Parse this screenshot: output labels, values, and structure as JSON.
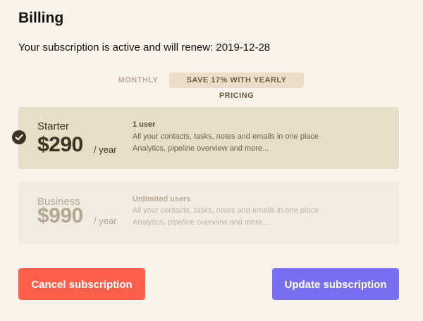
{
  "page": {
    "title": "Billing",
    "status_text": "Your subscription is active and will renew: 2019-12-28"
  },
  "billing_toggle": {
    "monthly_label": "MONTHLY",
    "yearly_label": "SAVE 17% WITH YEARLY PRICING",
    "selected": "yearly"
  },
  "plans": [
    {
      "name": "Starter",
      "price": "$290",
      "period": "/ year",
      "users": "1 user",
      "features": [
        "All your contacts, tasks, notes and emails in one place",
        "Analytics, pipeline overview and more..."
      ],
      "selected": true
    },
    {
      "name": "Business",
      "price": "$990",
      "period": "/ year",
      "users": "Unlimited users",
      "features": [
        "All your contacts, tasks, notes and emails in one place",
        "Analytics, pipeline overview and more..."
      ],
      "selected": false
    }
  ],
  "actions": {
    "cancel_label": "Cancel subscription",
    "update_label": "Update subscription"
  },
  "colors": {
    "background": "#f7f2ea",
    "selected_plan_bg": "#e6dec6",
    "unselected_plan_bg": "#f2ebe1",
    "cancel_button": "#fc604a",
    "update_button": "#786ef2",
    "check_badge": "#3b3423"
  },
  "icons": {
    "selected_plan": "check-circle-icon"
  }
}
